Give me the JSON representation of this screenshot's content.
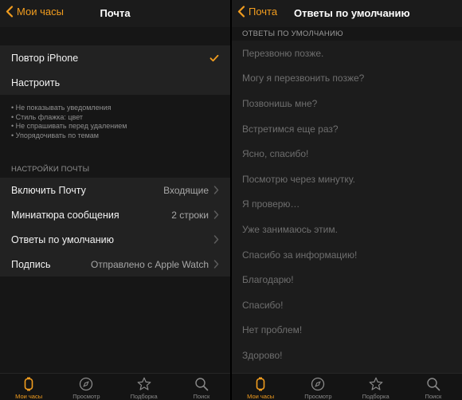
{
  "accent": "#f29d1f",
  "left": {
    "back_label": "Мои часы",
    "title": "Почта",
    "top_rows": [
      {
        "label": "Повтор iPhone",
        "checked": true
      },
      {
        "label": "Настроить"
      }
    ],
    "bullets": [
      "• Не показывать уведомления",
      "• Стиль флажка: цвет",
      "• Не спрашивать перед удалением",
      "• Упорядочивать по темам"
    ],
    "section_header": "НАСТРОЙКИ ПОЧТЫ",
    "settings_rows": [
      {
        "label": "Включить Почту",
        "value": "Входящие"
      },
      {
        "label": "Миниатюра сообщения",
        "value": "2 строки"
      },
      {
        "label": "Ответы по умолчанию",
        "value": ""
      },
      {
        "label": "Подпись",
        "value": "Отправлено с Apple Watch"
      }
    ]
  },
  "right": {
    "back_label": "Почта",
    "title": "Ответы по умолчанию",
    "section_header": "ОТВЕТЫ ПО УМОЛЧАНИЮ",
    "replies": [
      "Перезвоню позже.",
      "Могу я перезвонить позже?",
      "Позвонишь мне?",
      "Встретимся еще раз?",
      "Ясно, спасибо!",
      "Посмотрю через минутку.",
      "Я проверю…",
      "Уже занимаюсь этим.",
      "Спасибо за информацию!",
      "Благодарю!",
      "Спасибо!",
      "Нет проблем!",
      "Здорово!"
    ]
  },
  "tabbar": {
    "tabs": [
      {
        "label": "Мои часы",
        "icon": "watch-icon",
        "active": true
      },
      {
        "label": "Просмотр",
        "icon": "compass-icon"
      },
      {
        "label": "Подборка",
        "icon": "star-icon"
      },
      {
        "label": "Поиск",
        "icon": "search-icon"
      }
    ]
  }
}
